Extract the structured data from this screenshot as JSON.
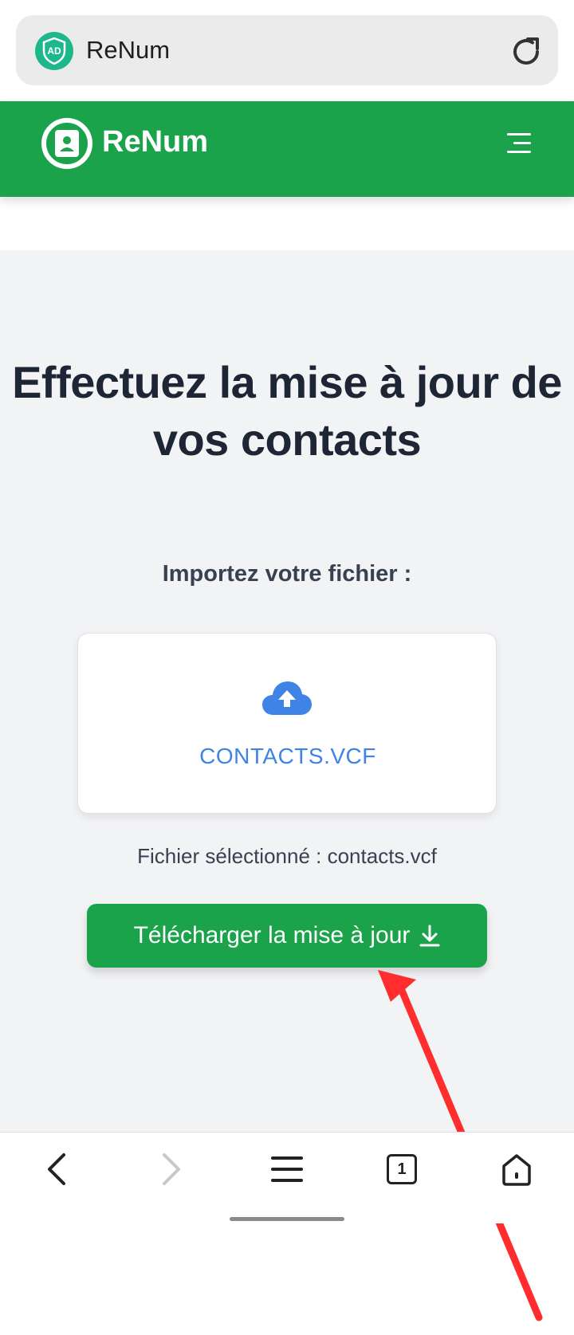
{
  "browser": {
    "badge_text": "AD",
    "page_title": "ReNum"
  },
  "header": {
    "brand": "ReNum"
  },
  "main": {
    "headline_line1": "Effectuez la mise à jour de",
    "headline_line2": "vos contacts",
    "import_label": "Importez votre fichier :",
    "upload_file_name": "CONTACTS.VCF",
    "selected_file_text": "Fichier sélectionné : contacts.vcf",
    "download_button_label": "Télécharger la mise à jour"
  },
  "bottom_nav": {
    "tab_count": "1"
  },
  "colors": {
    "brand_green": "#1aa34a",
    "link_blue": "#3f83e6",
    "annotation_red": "#ff2d2d"
  },
  "icons": [
    "ad-badge-icon",
    "reload-icon",
    "contact-book-icon",
    "hamburger-menu-icon",
    "cloud-upload-icon",
    "download-icon",
    "back-icon",
    "forward-icon",
    "menu-icon",
    "tabs-icon",
    "home-icon"
  ]
}
